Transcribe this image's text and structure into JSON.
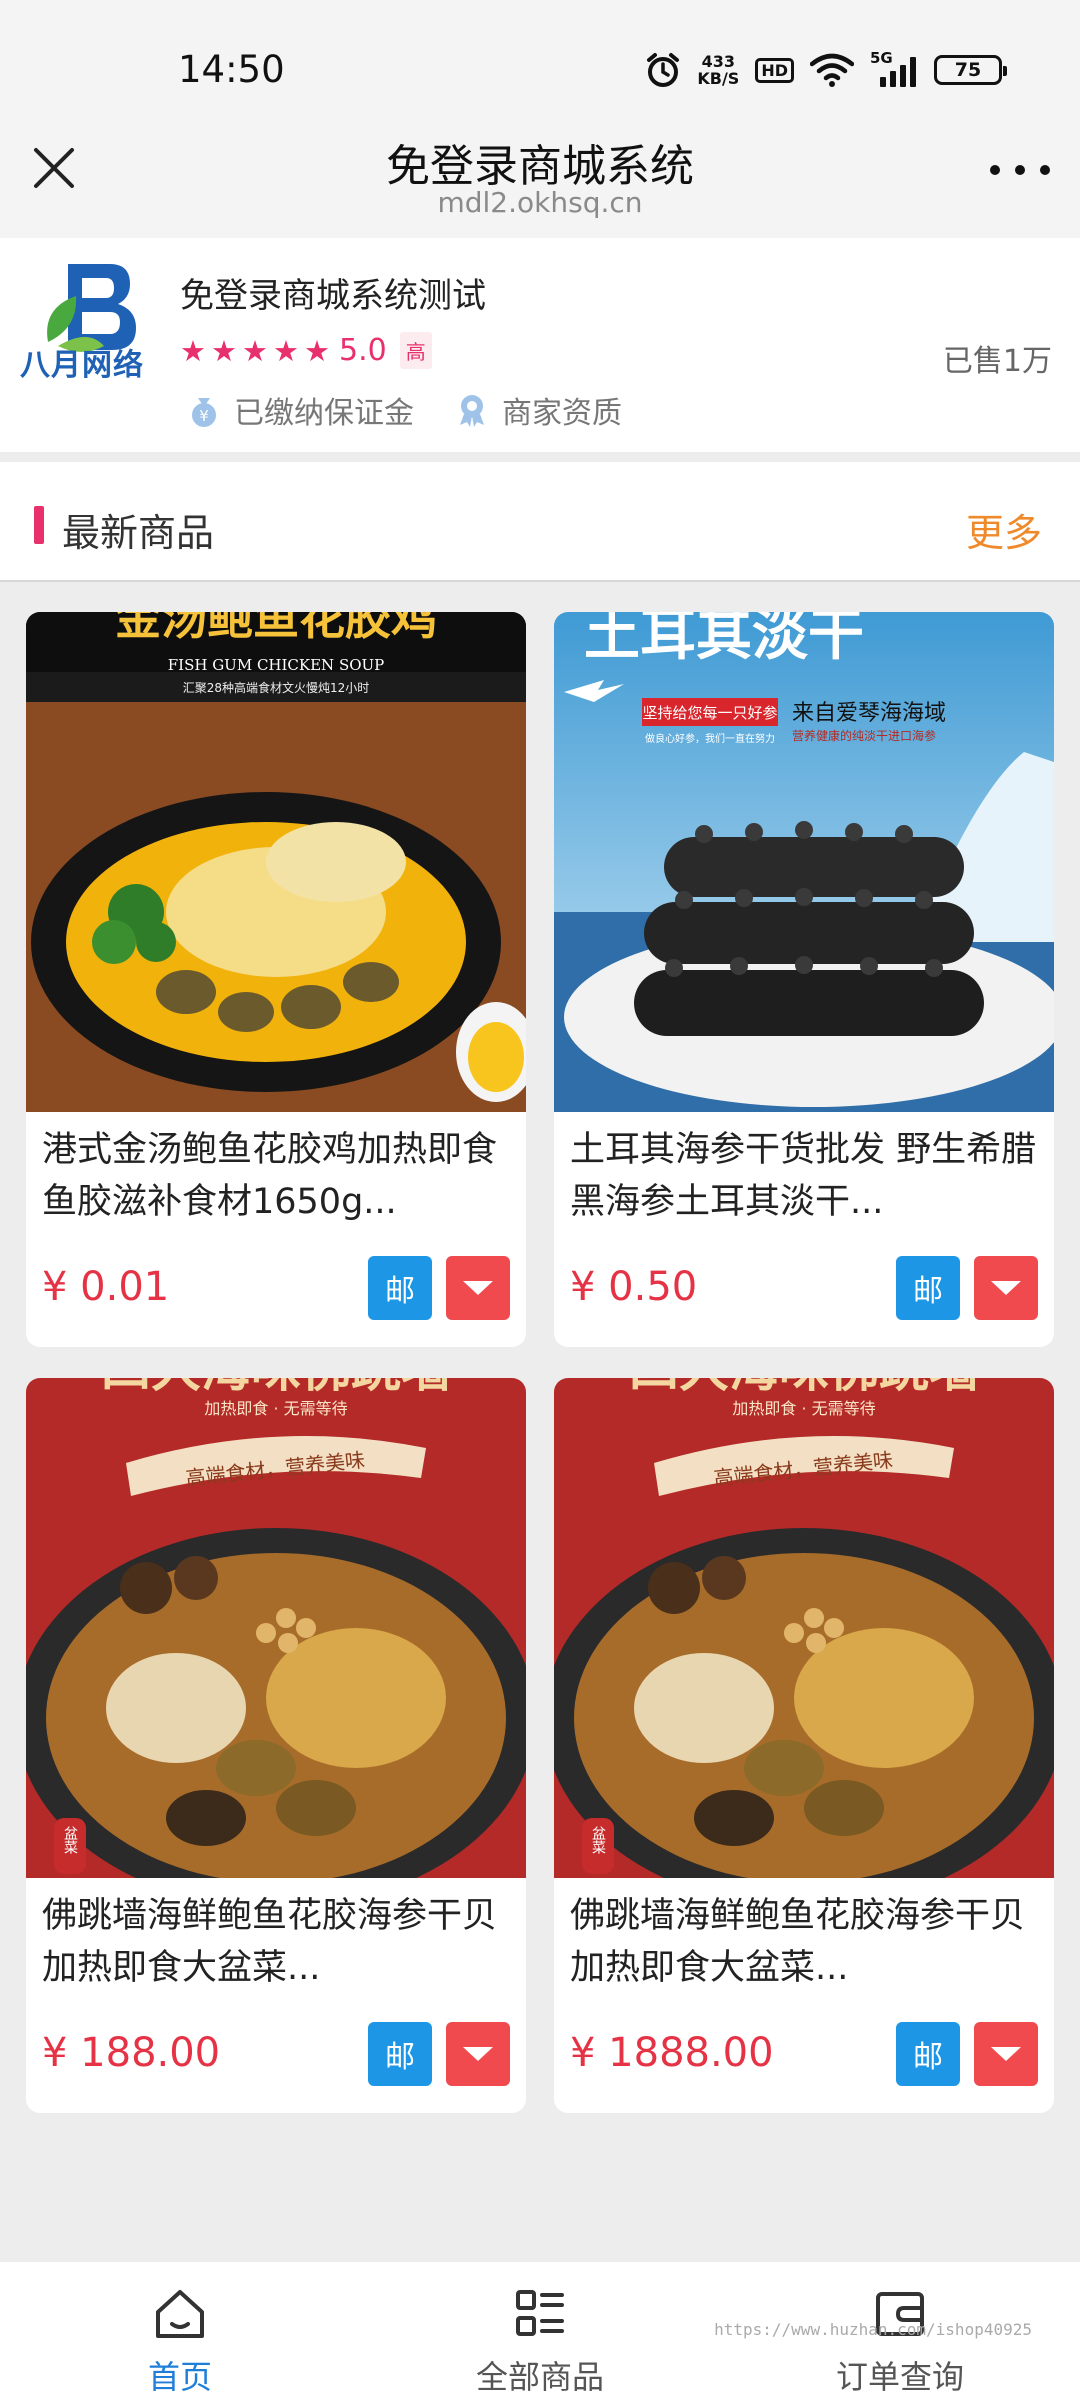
{
  "status_bar": {
    "time": "14:50",
    "net_speed_value": "433",
    "net_speed_unit": "KB/S",
    "hd_label": "HD",
    "network_label": "5G",
    "battery": "75"
  },
  "title_bar": {
    "title": "免登录商城系统",
    "url": "mdl2.okhsq.cn"
  },
  "shop": {
    "logo_text": "八月网络",
    "name": "免登录商城系统测试",
    "rating_score": "5.0",
    "rating_level": "高",
    "stars": 5,
    "sold": "已售1万",
    "badges": [
      {
        "label": "已缴纳保证金",
        "icon": "money-bag-icon"
      },
      {
        "label": "商家资质",
        "icon": "certificate-icon"
      }
    ]
  },
  "section": {
    "title": "最新商品",
    "more": "更多"
  },
  "products": [
    {
      "name": "港式金汤鲍鱼花胶鸡加热即食鱼胶滋补食材1650g...",
      "price": "¥ 0.01",
      "mail_label": "邮",
      "image_title": "金汤鲍鱼花胶鸡",
      "image_sub_en": "FISH GUM CHICKEN SOUP",
      "image_sub_cn": "汇聚28种高端食材文火慢炖12小时"
    },
    {
      "name": "土耳其海参干货批发 野生希腊黑海参土耳其淡干...",
      "price": "¥ 0.50",
      "mail_label": "邮",
      "image_title": "土耳其淡干",
      "image_tag": "坚持给您每一只好参",
      "image_tag_sub": "做良心好参，我们一直在努力",
      "image_caption": "来自爱琴海海域",
      "image_caption_sub": "营养健康的纯淡干进口海参"
    },
    {
      "name": "佛跳墙海鲜鲍鱼花胶海参干贝加热即食大盆菜...",
      "price": "¥ 188.00",
      "mail_label": "邮",
      "image_title": "四大海味佛跳墙",
      "image_sub": "加热即食 · 无需等待",
      "image_ribbon": "高端食材，营养美味",
      "image_seal": "盆菜"
    },
    {
      "name": "佛跳墙海鲜鲍鱼花胶海参干贝加热即食大盆菜...",
      "price": "¥ 1888.00",
      "mail_label": "邮",
      "image_title": "四大海味佛跳墙",
      "image_sub": "加热即食 · 无需等待",
      "image_ribbon": "高端食材，营养美味",
      "image_seal": "盆菜"
    }
  ],
  "bottom_nav": [
    {
      "label": "首页",
      "icon": "home-icon",
      "active": true
    },
    {
      "label": "全部商品",
      "icon": "grid-list-icon",
      "active": false
    },
    {
      "label": "订单查询",
      "icon": "wallet-icon",
      "active": false
    }
  ],
  "watermark": "https://www.huzhan.com/ishop40925",
  "colors": {
    "accent_pink": "#e8306c",
    "price_red": "#e53345",
    "more_orange": "#f0892a",
    "mail_blue": "#1e96e6",
    "nav_active_blue": "#1f7fd8"
  }
}
